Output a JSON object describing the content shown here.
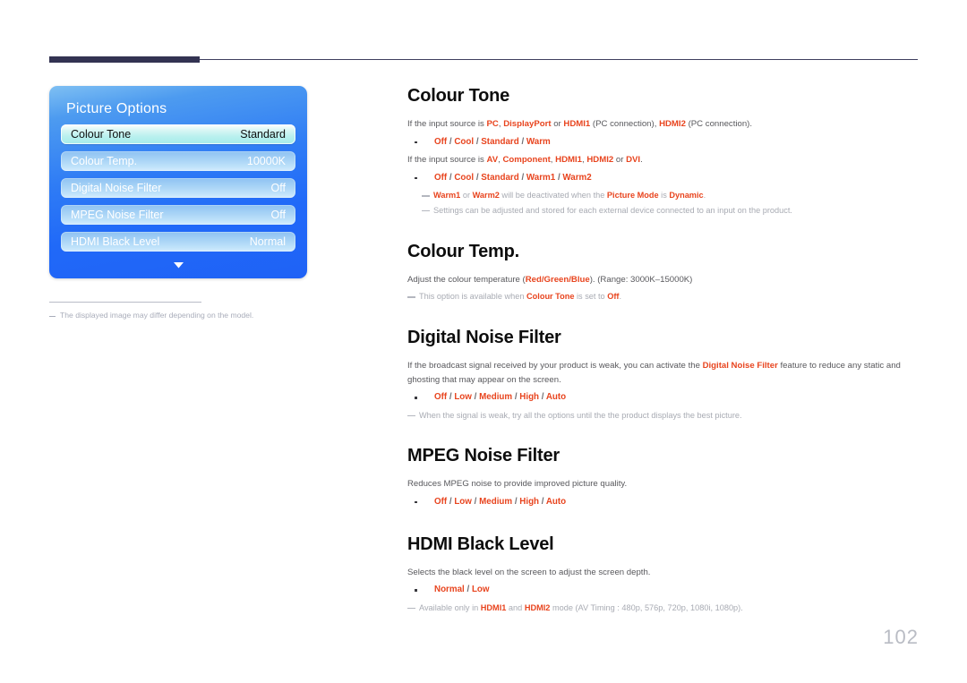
{
  "page": {
    "number": "102"
  },
  "osd": {
    "title": "Picture Options",
    "rows": [
      {
        "label": "Colour Tone",
        "value": "Standard",
        "selected": true
      },
      {
        "label": "Colour Temp.",
        "value": "10000K",
        "selected": false
      },
      {
        "label": "Digital Noise Filter",
        "value": "Off",
        "selected": false
      },
      {
        "label": "MPEG Noise Filter",
        "value": "Off",
        "selected": false
      },
      {
        "label": "HDMI Black Level",
        "value": "Normal",
        "selected": false
      }
    ],
    "more_icon": "chevron-down-icon",
    "footnote": "The displayed image may differ depending on the model."
  },
  "sections": {
    "colour_tone": {
      "title": "Colour Tone",
      "line1_a": "If the input source is ",
      "line1_pc": "PC",
      "line1_b": ", ",
      "line1_dp": "DisplayPort",
      "line1_c": " or ",
      "line1_hdmi1": "HDMI1",
      "line1_d": " (PC connection), ",
      "line1_hdmi2": "HDMI2",
      "line1_e": " (PC connection).",
      "options1": "Off / Cool / Standard / Warm",
      "line2_a": "If the input source is ",
      "line2_av": "AV",
      "line2_b": ", ",
      "line2_comp": "Component",
      "line2_c": ", ",
      "line2_hdmi1": "HDMI1",
      "line2_d": ", ",
      "line2_hdmi2": "HDMI2",
      "line2_e": " or ",
      "line2_dvi": "DVI",
      "line2_f": ".",
      "options2": "Off / Cool / Standard / Warm1 / Warm2",
      "note1_warm1": "Warm1",
      "note1_a": " or ",
      "note1_warm2": "Warm2",
      "note1_b": " will be deactivated when the ",
      "note1_pm": "Picture Mode",
      "note1_c": " is ",
      "note1_dyn": "Dynamic",
      "note1_d": ".",
      "note2": "Settings can be adjusted and stored for each external device connected to an input on the product."
    },
    "colour_temp": {
      "title": "Colour Temp.",
      "line1_a": "Adjust the colour temperature (",
      "line1_rgb": "Red/Green/Blue",
      "line1_b": "). (Range: 3000K–15000K)",
      "note_a": "This option is available when ",
      "note_ct": "Colour Tone",
      "note_b": " is set to ",
      "note_off": "Off",
      "note_c": "."
    },
    "digital_noise_filter": {
      "title": "Digital Noise Filter",
      "line1_a": "If the broadcast signal received by your product is weak, you can activate the ",
      "line1_kw": "Digital Noise Filter",
      "line1_b": " feature to reduce any static and ghosting that may appear on the screen.",
      "options": "Off / Low / Medium / High / Auto",
      "note": "When the signal is weak, try all the options until the the product displays the best picture."
    },
    "mpeg_noise_filter": {
      "title": "MPEG Noise Filter",
      "line1": "Reduces MPEG noise to provide improved picture quality.",
      "options": "Off / Low / Medium / High / Auto"
    },
    "hdmi_black_level": {
      "title": "HDMI Black Level",
      "line1": "Selects the black level on the screen to adjust the screen depth.",
      "options": "Normal / Low",
      "note_a": "Available only in ",
      "note_hdmi1": "HDMI1",
      "note_b": " and ",
      "note_hdmi2": "HDMI2",
      "note_c": " mode (AV Timing : 480p, 576p, 720p, 1080i, 1080p)."
    }
  }
}
